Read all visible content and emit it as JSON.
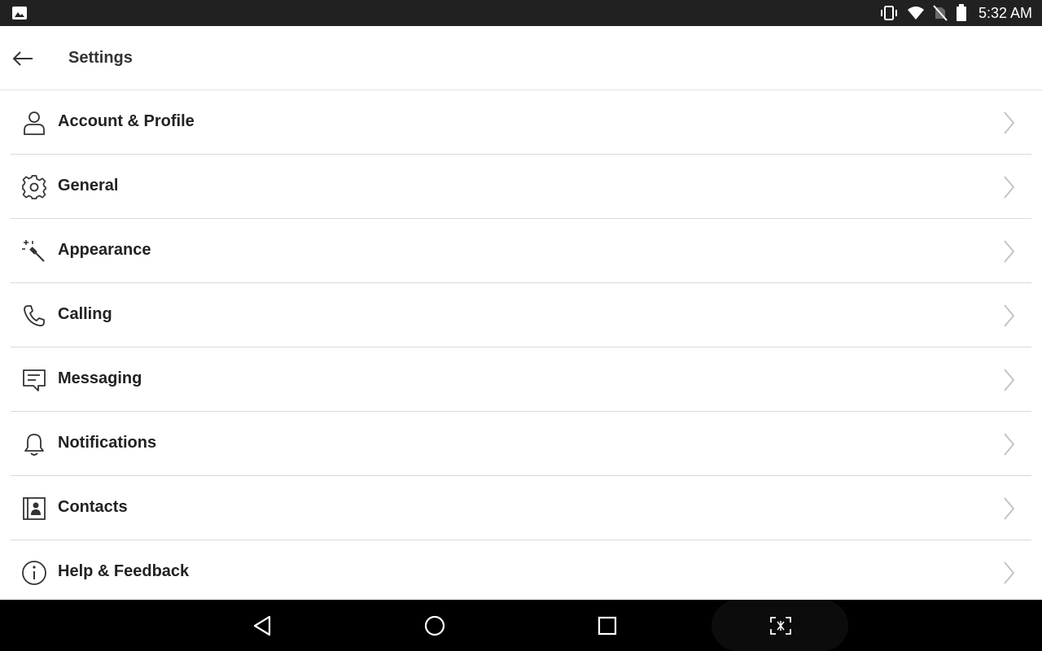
{
  "status_bar": {
    "time": "5:32 AM",
    "left_icon": "image-notification-icon",
    "right_icons": [
      "vibrate-icon",
      "wifi-icon",
      "no-sim-icon",
      "battery-icon"
    ]
  },
  "toolbar": {
    "back_icon": "arrow-left-icon",
    "title": "Settings"
  },
  "settings": {
    "items": [
      {
        "label": "Account & Profile",
        "icon": "person-icon"
      },
      {
        "label": "General",
        "icon": "gear-icon"
      },
      {
        "label": "Appearance",
        "icon": "magic-wand-icon"
      },
      {
        "label": "Calling",
        "icon": "phone-icon"
      },
      {
        "label": "Messaging",
        "icon": "message-icon"
      },
      {
        "label": "Notifications",
        "icon": "bell-icon"
      },
      {
        "label": "Contacts",
        "icon": "contacts-book-icon"
      },
      {
        "label": "Help & Feedback",
        "icon": "info-icon"
      }
    ]
  },
  "nav_bar": {
    "buttons": [
      "back-triangle-icon",
      "home-circle-icon",
      "recents-square-icon",
      "screenshot-icon"
    ]
  },
  "colors": {
    "status_bar_bg": "#212121",
    "nav_bar_bg": "#000000",
    "divider": "#d9d9d9",
    "text": "#222222"
  }
}
